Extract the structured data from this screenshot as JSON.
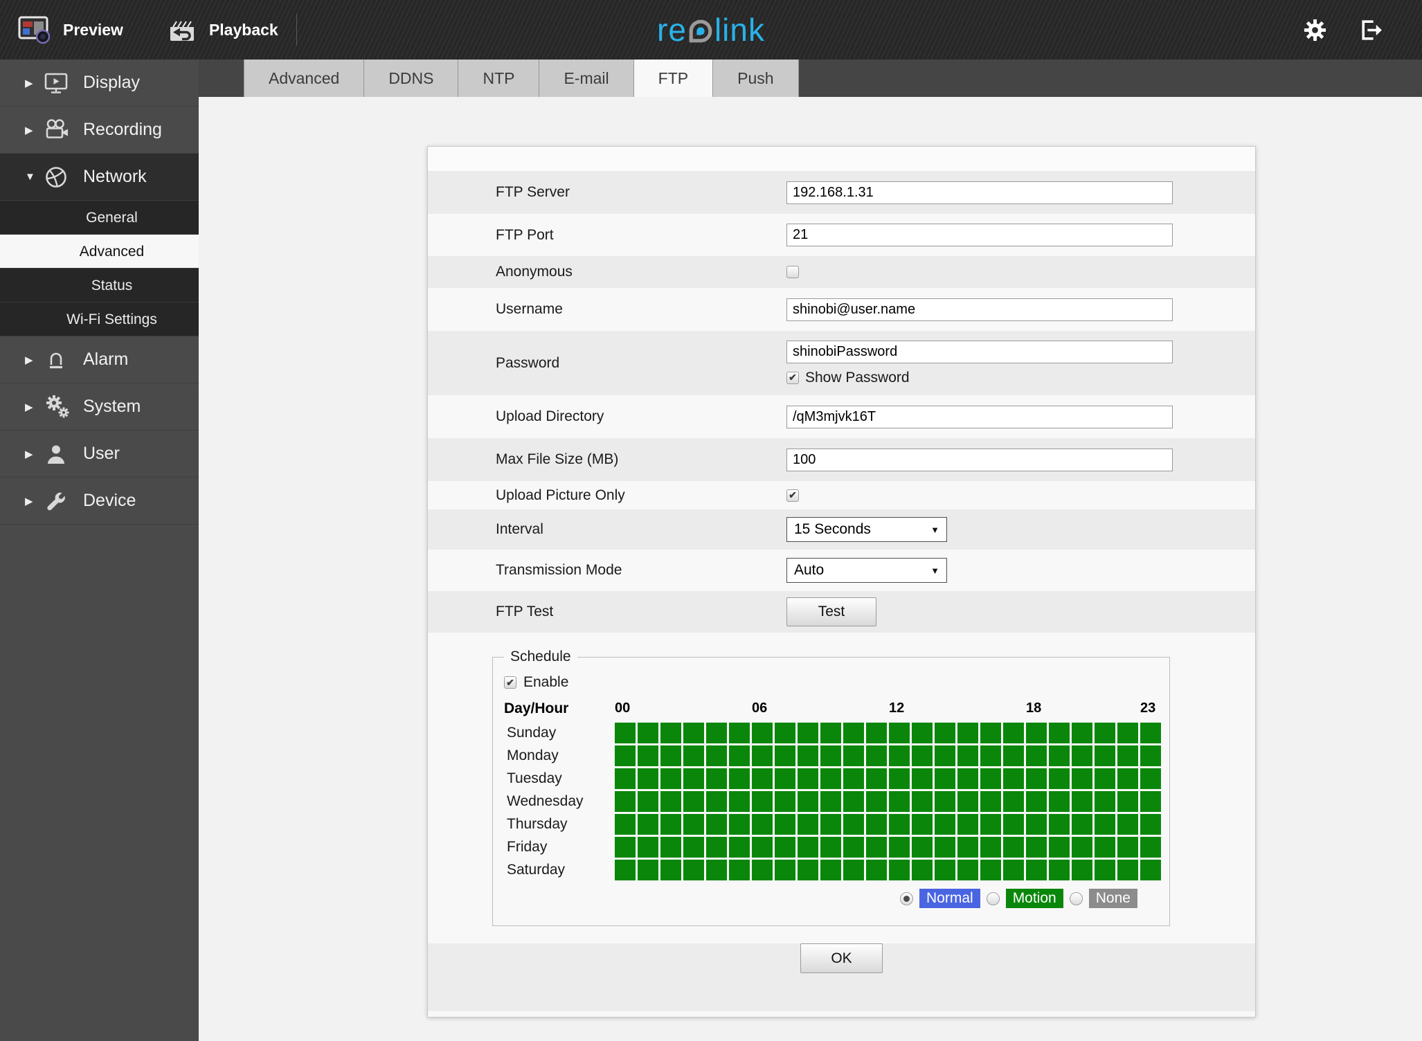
{
  "topbar": {
    "preview_label": "Preview",
    "playback_label": "Playback",
    "logo_text_pre": "re",
    "logo_text_post": "link",
    "logo_color": "#29b2e9"
  },
  "sidebar": {
    "items": [
      {
        "label": "Display",
        "slug": "display",
        "icon": "display-icon",
        "expanded": false
      },
      {
        "label": "Recording",
        "slug": "recording",
        "icon": "recording-icon",
        "expanded": false
      },
      {
        "label": "Network",
        "slug": "network",
        "icon": "network-icon",
        "expanded": true,
        "children": [
          {
            "label": "General",
            "slug": "general",
            "selected": false
          },
          {
            "label": "Advanced",
            "slug": "advanced",
            "selected": true
          },
          {
            "label": "Status",
            "slug": "status",
            "selected": false
          },
          {
            "label": "Wi-Fi Settings",
            "slug": "wifi-settings",
            "selected": false
          }
        ]
      },
      {
        "label": "Alarm",
        "slug": "alarm",
        "icon": "alarm-icon",
        "expanded": false
      },
      {
        "label": "System",
        "slug": "system",
        "icon": "system-icon",
        "expanded": false
      },
      {
        "label": "User",
        "slug": "user",
        "icon": "user-icon",
        "expanded": false
      },
      {
        "label": "Device",
        "slug": "device",
        "icon": "device-icon",
        "expanded": false
      }
    ]
  },
  "tabs": {
    "items": [
      "Advanced",
      "DDNS",
      "NTP",
      "E-mail",
      "FTP",
      "Push"
    ],
    "active": "FTP"
  },
  "form": {
    "rows": [
      {
        "label": "FTP Server",
        "name": "ftp-server",
        "type": "text",
        "value": "192.168.1.31"
      },
      {
        "label": "FTP Port",
        "name": "ftp-port",
        "type": "text",
        "value": "21"
      },
      {
        "label": "Anonymous",
        "name": "anonymous",
        "type": "checkbox",
        "checked": false
      },
      {
        "label": "Username",
        "name": "username",
        "type": "text",
        "value": "shinobi@user.name"
      },
      {
        "label": "Password",
        "name": "password",
        "type": "password",
        "value": "shinobiPassword",
        "show_password": {
          "label": "Show Password",
          "checked": true
        }
      },
      {
        "label": "Upload Directory",
        "name": "upload-directory",
        "type": "text",
        "value": "/qM3mjvk16T"
      },
      {
        "label": "Max File Size (MB)",
        "name": "max-file-size",
        "type": "text",
        "value": "100"
      },
      {
        "label": "Upload Picture Only",
        "name": "upload-picture-only",
        "type": "checkbox",
        "checked": true
      },
      {
        "label": "Interval",
        "name": "interval",
        "type": "select",
        "value": "15 Seconds"
      },
      {
        "label": "Transmission Mode",
        "name": "transmission-mode",
        "type": "select",
        "value": "Auto"
      },
      {
        "label": "FTP Test",
        "name": "ftp-test",
        "type": "button",
        "value": "Test"
      }
    ]
  },
  "schedule": {
    "legend": "Schedule",
    "enable": {
      "label": "Enable",
      "checked": true
    },
    "header_label": "Day/Hour",
    "hours_total": 24,
    "hour_labels": [
      {
        "text": "00",
        "col": 0
      },
      {
        "text": "06",
        "col": 6
      },
      {
        "text": "12",
        "col": 12
      },
      {
        "text": "18",
        "col": 18
      },
      {
        "text": "23",
        "col": 23
      }
    ],
    "days": [
      "Sunday",
      "Monday",
      "Tuesday",
      "Wednesday",
      "Thursday",
      "Friday",
      "Saturday"
    ],
    "cells": {
      "all": "motion"
    },
    "modes": [
      {
        "label": "Normal",
        "value": "normal",
        "color": "#4a65e2",
        "selected": true
      },
      {
        "label": "Motion",
        "value": "motion",
        "color": "#0a870a",
        "selected": false
      },
      {
        "label": "None",
        "value": "none",
        "color": "#8c8c8c",
        "selected": false
      }
    ]
  },
  "ok_label": "OK"
}
